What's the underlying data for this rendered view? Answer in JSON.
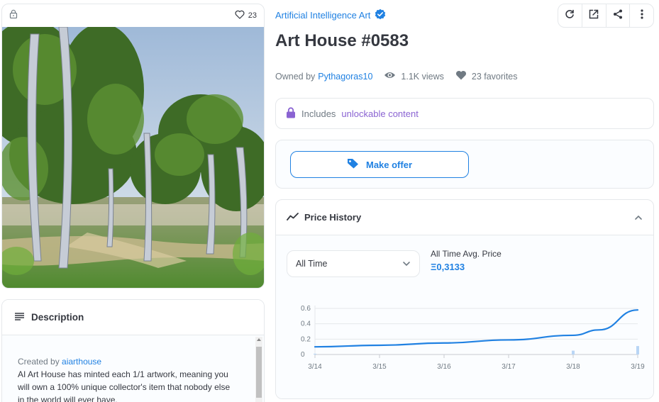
{
  "image_card": {
    "favorite_count": "23"
  },
  "description": {
    "title": "Description",
    "created_by_label": "Created by",
    "creator": "aiarthouse",
    "text": "AI Art House has minted each 1/1 artwork, meaning you will own a 100% unique collector's item that nobody else in the world will ever have."
  },
  "collection": {
    "name": "Artificial Intelligence Art",
    "verified": true
  },
  "item": {
    "title": "Art House #0583"
  },
  "owner": {
    "owned_by_label": "Owned by",
    "owner_name": "Pythagoras10",
    "views": "1.1K views",
    "favorites": "23 favorites"
  },
  "unlockable": {
    "prefix": "Includes",
    "link": "unlockable content"
  },
  "offer": {
    "button_label": "Make offer"
  },
  "price_history": {
    "title": "Price History",
    "range_selected": "All Time",
    "avg_label": "All Time Avg. Price",
    "avg_value": "Ξ0,3133"
  },
  "toolbar": {
    "icons": [
      "refresh-icon",
      "external-link-icon",
      "share-icon",
      "more-icon"
    ]
  },
  "colors": {
    "accent": "#2081e2",
    "unlockable": "#8a63d2",
    "text": "#353840",
    "muted": "#707a83",
    "border": "#e5e8eb"
  },
  "chart_data": {
    "type": "line",
    "x_tick_labels": [
      "3/14",
      "3/15",
      "3/16",
      "3/17",
      "3/18",
      "3/19"
    ],
    "y_tick_labels": [
      "0",
      "0.2",
      "0.4",
      "0.6"
    ],
    "ylim": [
      0,
      0.6
    ],
    "xlim": [
      0,
      5
    ],
    "grid": true,
    "series": [
      {
        "x": [
          0,
          1,
          2,
          3,
          4,
          4.4,
          5
        ],
        "y": [
          0.1,
          0.12,
          0.15,
          0.19,
          0.25,
          0.32,
          0.58
        ]
      }
    ],
    "volume_bars": [
      {
        "x": 0,
        "value": 0.01
      },
      {
        "x": 4,
        "value": 0.05
      },
      {
        "x": 5,
        "value": 0.11
      }
    ]
  }
}
